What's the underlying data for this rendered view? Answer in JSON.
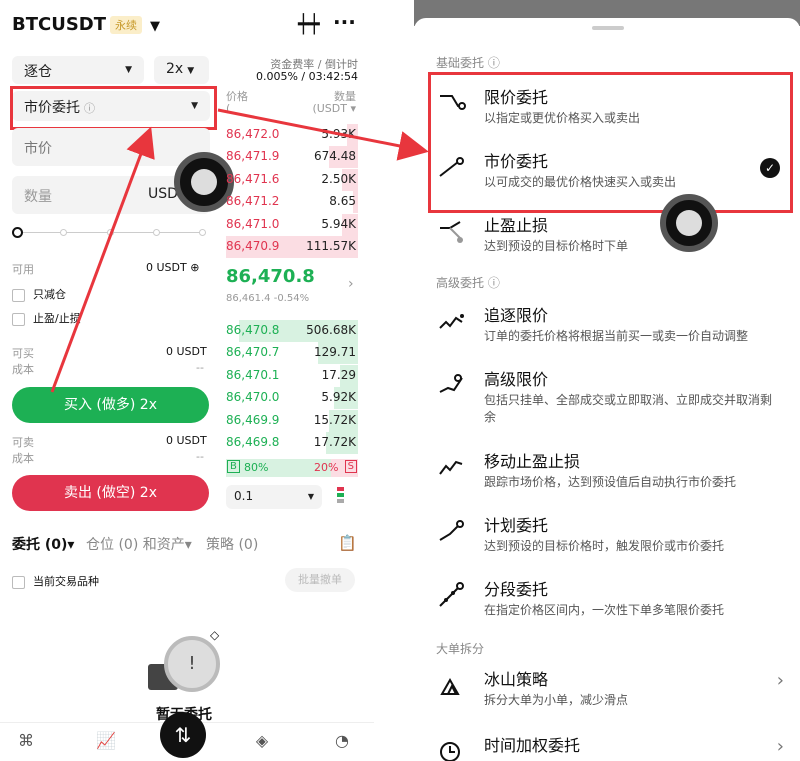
{
  "left": {
    "pair": "BTCUSDT",
    "tag": "永续",
    "margin_mode": "逐仓",
    "leverage": "2x",
    "funding_label": "资金费率 / 倒计时",
    "funding_value": "0.005% / 03:42:54",
    "order_type": "市价委托",
    "price_field": "市价",
    "qty_placeholder": "数量",
    "qty_unit": "USD",
    "col_price": "价格",
    "col_price_unit": "(",
    "col_qty": "数量",
    "col_qty_unit": "(USDT ▾",
    "asks": [
      {
        "p": "86,472.0",
        "q": "5.93K"
      },
      {
        "p": "86,471.9",
        "q": "674.48"
      },
      {
        "p": "86,471.6",
        "q": "2.50K"
      },
      {
        "p": "86,471.2",
        "q": "8.65"
      },
      {
        "p": "86,471.0",
        "q": "5.94K"
      },
      {
        "p": "86,470.9",
        "q": "111.57K"
      }
    ],
    "last_price": "86,470.8",
    "mark_line": "86,461.4 -0.54%",
    "bids": [
      {
        "p": "86,470.8",
        "q": "506.68K"
      },
      {
        "p": "86,470.7",
        "q": "129.71"
      },
      {
        "p": "86,470.1",
        "q": "17.29"
      },
      {
        "p": "86,470.0",
        "q": "5.92K"
      },
      {
        "p": "86,469.9",
        "q": "15.72K"
      },
      {
        "p": "86,469.8",
        "q": "17.72K"
      }
    ],
    "ratio_b": "B",
    "ratio_b_val": "80%",
    "ratio_s_val": "20%",
    "ratio_s": "S",
    "depth": "0.1",
    "avail_label": "可用",
    "avail_value": "0 USDT",
    "reduce_only": "只减仓",
    "tpsl": "止盈/止损",
    "can_buy": "可买",
    "can_buy_val": "0 USDT",
    "cost1": "成本",
    "cost1_val": "--",
    "buy_btn": "买入 (做多) 2x",
    "can_sell": "可卖",
    "can_sell_val": "0 USDT",
    "cost2": "成本",
    "cost2_val": "--",
    "sell_btn": "卖出 (做空) 2x",
    "tab_orders": "委托 (0)▾",
    "tab_positions": "仓位 (0) 和资产▾",
    "tab_strategy": "策略 (0)",
    "current_pair": "当前交易品种",
    "batch_cancel": "批量撤单",
    "empty_text": "暂无委托"
  },
  "right": {
    "sect_basic": "基础委托 ⓘ",
    "sect_adv": "高级委托 ⓘ",
    "sect_big": "大单拆分",
    "options": [
      {
        "title": "限价委托",
        "desc": "以指定或更优价格买入或卖出",
        "icon": "limit-order-icon"
      },
      {
        "title": "市价委托",
        "desc": "以可成交的最优价格快速买入或卖出",
        "icon": "market-order-icon"
      },
      {
        "title": "止盈止损",
        "desc": "达到预设的目标价格时下单",
        "icon": "tpsl-icon"
      },
      {
        "title": "追逐限价",
        "desc": "订单的委托价格将根据当前买一或卖一价自动调整",
        "icon": "chase-limit-icon"
      },
      {
        "title": "高级限价",
        "desc": "包括只挂单、全部成交或立即取消、立即成交并取消剩余",
        "icon": "advanced-limit-icon"
      },
      {
        "title": "移动止盈止损",
        "desc": "跟踪市场价格，达到预设值后自动执行市价委托",
        "icon": "trailing-stop-icon"
      },
      {
        "title": "计划委托",
        "desc": "达到预设的目标价格时，触发限价或市价委托",
        "icon": "trigger-order-icon"
      },
      {
        "title": "分段委托",
        "desc": "在指定价格区间内，一次性下单多笔限价委托",
        "icon": "scaled-order-icon"
      },
      {
        "title": "冰山策略",
        "desc": "拆分大单为小单，减少滑点",
        "icon": "iceberg-icon"
      },
      {
        "title": "时间加权委托",
        "desc": "",
        "icon": "twap-icon"
      }
    ]
  },
  "colors": {
    "green": "#1db054",
    "red": "#e0344f",
    "highlight": "#e8363d"
  }
}
